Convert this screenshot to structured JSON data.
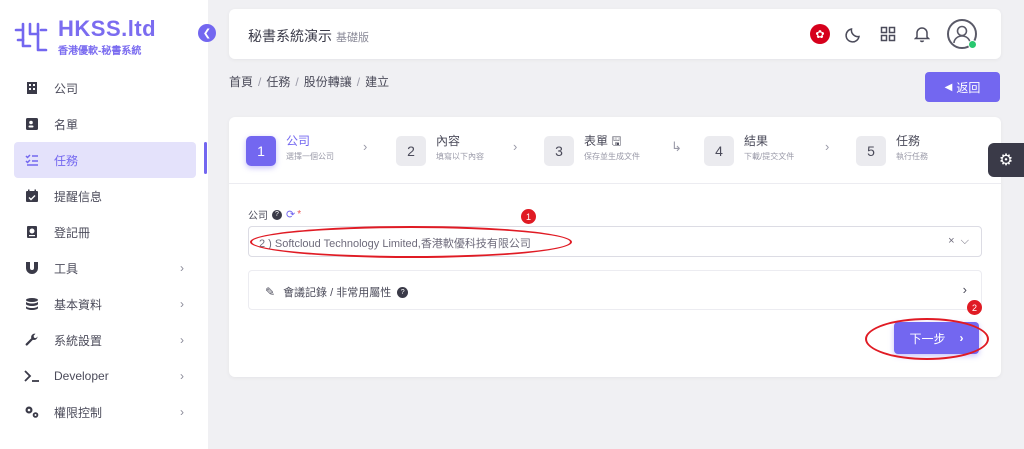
{
  "logo": {
    "title": "HKSS.ltd",
    "subtitle": "香港優軟-秘書系統",
    "brand_color": "#7367f0"
  },
  "sidebar": {
    "collapse_icon": "chevron-left-icon",
    "items": [
      {
        "label": "公司",
        "icon": "building-icon",
        "has_submenu": false,
        "active": false
      },
      {
        "label": "名單",
        "icon": "contact-card-icon",
        "has_submenu": false,
        "active": false
      },
      {
        "label": "任務",
        "icon": "checklist-icon",
        "has_submenu": false,
        "active": true
      },
      {
        "label": "提醒信息",
        "icon": "calendar-check-icon",
        "has_submenu": false,
        "active": false
      },
      {
        "label": "登記冊",
        "icon": "register-book-icon",
        "has_submenu": false,
        "active": false
      },
      {
        "label": "工具",
        "icon": "magnet-icon",
        "has_submenu": true,
        "active": false
      },
      {
        "label": "基本資料",
        "icon": "database-icon",
        "has_submenu": true,
        "active": false
      },
      {
        "label": "系統設置",
        "icon": "wrench-icon",
        "has_submenu": true,
        "active": false
      },
      {
        "label": "Developer",
        "icon": "terminal-icon",
        "has_submenu": true,
        "active": false
      },
      {
        "label": "權限控制",
        "icon": "cogs-icon",
        "has_submenu": true,
        "active": false
      }
    ]
  },
  "header": {
    "title": "秘書系統演示",
    "subtitle": "基礎版",
    "icons": [
      "hk-flag-icon",
      "moon-icon",
      "grid-icon",
      "bell-icon",
      "user-avatar-icon"
    ]
  },
  "breadcrumb": [
    "首頁",
    "任務",
    "股份轉讓",
    "建立"
  ],
  "back_button": {
    "label": "返回"
  },
  "stepper": [
    {
      "num": "1",
      "title": "公司",
      "desc": "選擇一個公司",
      "active": true
    },
    {
      "num": "2",
      "title": "內容",
      "desc": "填寫以下內容",
      "active": false
    },
    {
      "num": "3",
      "title": "表單",
      "desc": "保存並生成文件",
      "active": false
    },
    {
      "num": "4",
      "title": "結果",
      "desc": "下載/提交文件",
      "active": false
    },
    {
      "num": "5",
      "title": "任務",
      "desc": "執行任務",
      "active": false
    }
  ],
  "company_field": {
    "label": "公司",
    "required_mark": "*",
    "value": "2 ) Softcloud Technology Limited,香港軟優科技有限公司"
  },
  "meeting_panel": {
    "label": "會議記錄 / 非常用屬性"
  },
  "next_button": {
    "label": "下一步"
  },
  "annotations": {
    "badge_1": "1",
    "badge_2": "2",
    "color": "#e01b24"
  }
}
